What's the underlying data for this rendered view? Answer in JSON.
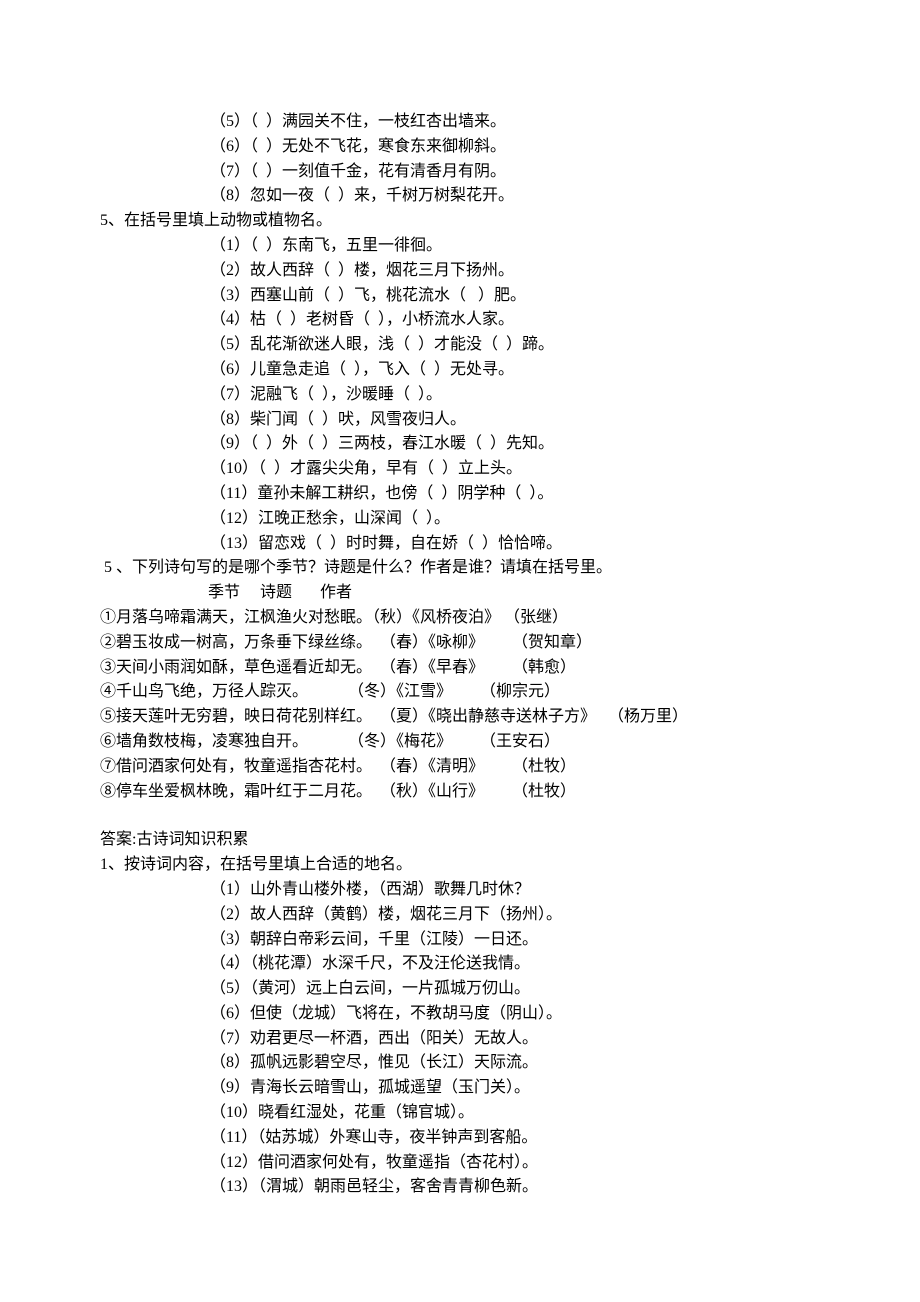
{
  "section4": {
    "items": [
      "（5）（  ）满园关不住，一枝红杏出墙来。",
      "（6）（  ）无处不飞花，寒食东来御柳斜。",
      "（7）（  ）一刻值千金，花有清香月有阴。",
      "（8）忽如一夜（  ）来，千树万树梨花开。"
    ]
  },
  "section5": {
    "title": "5、在括号里填上动物或植物名。",
    "items": [
      "（1）（  ）东南飞，五里一徘徊。",
      "（2）故人西辞（  ）楼，烟花三月下扬州。",
      "（3）西塞山前（  ）飞，桃花流水（   ）肥。",
      "（4）枯（  ）老树昏（  ），小桥流水人家。",
      "（5）乱花渐欲迷人眼，浅（  ）才能没（  ）蹄。",
      "（6）儿童急走追（  ），飞入（  ）无处寻。",
      "（7）泥融飞（  ），沙暖睡（  ）。",
      "（8）柴门闻（  ）吠，风雪夜归人。",
      "（9）（  ）外（  ）三两枝，春江水暖（  ）先知。",
      "（10）（  ）才露尖尖角，早有（  ）立上头。",
      "（11）童孙未解工耕织，也傍（  ）阴学种（  ）。",
      "（12）江晚正愁余，山深闻（  ）。",
      "（13）留恋戏（  ）时时舞，自在娇（  ）恰恰啼。"
    ]
  },
  "section5b": {
    "title": " 5 、下列诗句写的是哪个季节？诗题是什么？作者是谁？请填在括号里。",
    "header": "                           季节     诗题       作者",
    "rows": [
      "①月落乌啼霜满天，江枫渔火对愁眠。（秋）《风桥夜泊》 （张继）",
      "②碧玉妆成一树高，万条垂下绿丝绦。  （春）《咏柳》       （贺知章）",
      "③天间小雨润如酥，草色遥看近却无。  （春）《早春》       （韩愈）",
      "④千山鸟飞绝，万径人踪灭。          （冬）《江雪》       （柳宗元）",
      "⑤接天莲叶无穷碧，映日荷花别样红。  （夏）《晓出静慈寺送林子方》   （杨万里）",
      "⑥墙角数枝梅，凌寒独自开。          （冬）《梅花》       （王安石）",
      "⑦借问酒家何处有，牧童遥指杏花村。  （春）《清明》       （杜牧）",
      "⑧停车坐爱枫林晚，霜叶红于二月花。  （秋）《山行》       （杜牧）"
    ]
  },
  "answers": {
    "header": "答案:古诗词知识积累",
    "section1": {
      "title": "1、按诗词内容，在括号里填上合适的地名。",
      "items": [
        "（1）山外青山楼外楼，（西湖）歌舞几时休？",
        "（2）故人西辞（黄鹤）楼，烟花三月下（扬州）。",
        "（3）朝辞白帝彩云间，千里（江陵）一日还。",
        "（4）（桃花潭）水深千尺，不及汪伦送我情。",
        "（5）（黄河）远上白云间，一片孤城万仞山。",
        "（6）但使（龙城）飞将在，不教胡马度（阴山）。",
        "（7）劝君更尽一杯酒，西出（阳关）无故人。",
        "（8）孤帆远影碧空尽，惟见（长江）天际流。",
        "（9）青海长云暗雪山，孤城遥望（玉门关）。",
        "（10）晓看红湿处，花重（锦官城）。",
        "（11）（姑苏城）外寒山寺，夜半钟声到客船。",
        "（12）借问酒家何处有，牧童遥指（杏花村）。",
        "（13）（渭城）朝雨邑轻尘，客舍青青柳色新。"
      ]
    }
  }
}
